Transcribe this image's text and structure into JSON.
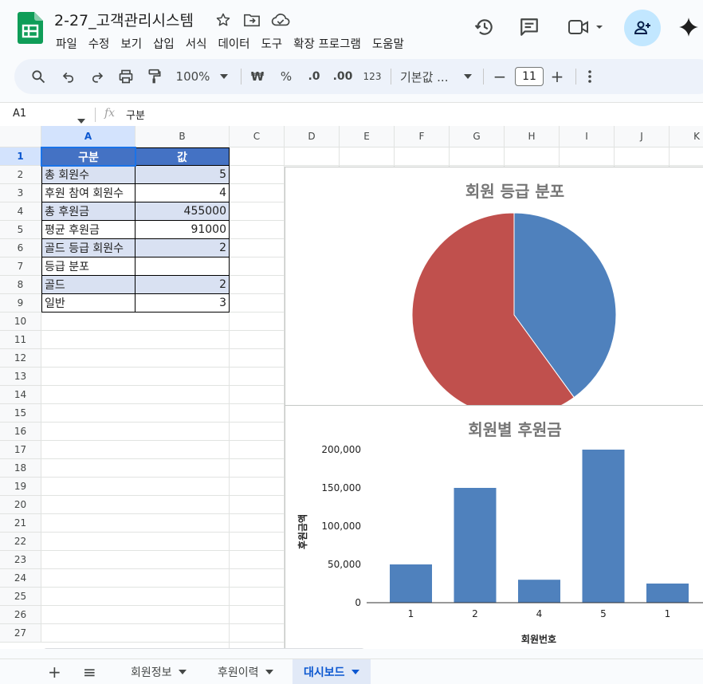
{
  "app": {
    "doc_title": "2-27_고객관리시스템"
  },
  "menu": [
    "파일",
    "수정",
    "보기",
    "삽입",
    "서식",
    "데이터",
    "도구",
    "확장 프로그램",
    "도움말"
  ],
  "toolbar": {
    "zoom": "100%",
    "currency": "₩",
    "percent": "%",
    "dec_decrease": ".0",
    "dec_increase": ".00",
    "number_format": "123",
    "font": "기본값 ...",
    "font_size": "11",
    "minus": "−",
    "plus": "+"
  },
  "formula_bar": {
    "cell_ref": "A1",
    "fx": "fx",
    "content": "구분"
  },
  "grid": {
    "columns": [
      "A",
      "B",
      "C",
      "D",
      "E",
      "F",
      "G",
      "H",
      "I",
      "J",
      "K"
    ],
    "rows": [
      "1",
      "2",
      "3",
      "4",
      "5",
      "6",
      "7",
      "8",
      "9",
      "10",
      "11",
      "12",
      "13",
      "14",
      "15",
      "16",
      "17",
      "18",
      "19",
      "20",
      "21",
      "22",
      "23",
      "24",
      "25",
      "26",
      "27"
    ],
    "header": [
      "구분",
      "값"
    ],
    "data": [
      [
        "총 회원수",
        "5"
      ],
      [
        "후원 참여 회원수",
        "4"
      ],
      [
        "총 후원금",
        "455000"
      ],
      [
        "평균 후원금",
        "91000"
      ],
      [
        "골드 등급 회원수",
        "2"
      ],
      [
        "등급 분포",
        ""
      ],
      [
        "골드",
        "2"
      ],
      [
        "일반",
        "3"
      ]
    ],
    "colors": {
      "header_bg": "#4472c4",
      "band_bg": "#d9e1f2"
    }
  },
  "chart_data": [
    {
      "type": "pie",
      "title": "회원 등급 분포",
      "values": [
        2,
        3
      ],
      "colors": [
        "#4f81bd",
        "#c0504d"
      ],
      "legend": "none"
    },
    {
      "type": "bar",
      "title": "회원별 후원금",
      "categories": [
        "1",
        "2",
        "4",
        "5",
        "1"
      ],
      "values": [
        50000,
        150000,
        30000,
        200000,
        25000
      ],
      "xlabel": "회원번호",
      "ylabel": "후원금액",
      "ylim": [
        0,
        200000
      ],
      "yticks": [
        "0",
        "50,000",
        "100,000",
        "150,000",
        "200,000"
      ],
      "color": "#4f81bd",
      "grid": false
    }
  ],
  "sheets": [
    {
      "label": "회원정보",
      "active": false
    },
    {
      "label": "후원이력",
      "active": false
    },
    {
      "label": "대시보드",
      "active": true
    }
  ],
  "icons": {
    "add_sheet": "+",
    "all_sheets": "≡"
  }
}
